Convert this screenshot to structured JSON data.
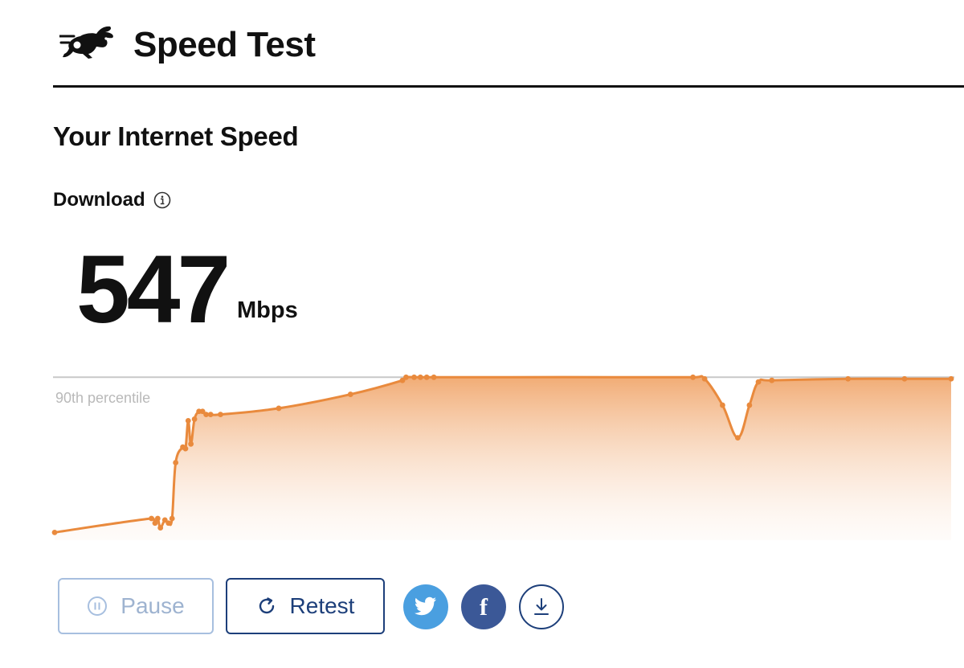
{
  "header": {
    "title": "Speed Test",
    "logo_icon": "rabbit-icon"
  },
  "main": {
    "heading": "Your Internet Speed",
    "metric_label": "Download",
    "info_icon": "info-icon",
    "speed_value": "547",
    "speed_unit": "Mbps"
  },
  "chart_data": {
    "type": "area",
    "title": "",
    "xlabel": "",
    "ylabel": "",
    "reference_line": {
      "label": "90th percentile",
      "value": 1.0
    },
    "x": [
      0,
      10.8,
      11.2,
      11.5,
      11.8,
      12.3,
      12.7,
      13.1,
      13.5,
      14.3,
      14.6,
      14.9,
      15.2,
      15.6,
      16.1,
      16.5,
      16.9,
      17.4,
      18.5,
      25.0,
      33.0,
      38.8,
      39.2,
      40.1,
      40.8,
      41.5,
      42.3,
      71.2,
      72.5,
      74.5,
      76.2,
      77.5,
      78.5,
      80.0,
      88.5,
      94.8,
      100
    ],
    "values": [
      0.0,
      0.09,
      0.06,
      0.09,
      0.03,
      0.08,
      0.06,
      0.09,
      0.45,
      0.55,
      0.54,
      0.72,
      0.57,
      0.73,
      0.78,
      0.78,
      0.76,
      0.76,
      0.76,
      0.8,
      0.89,
      0.98,
      1.0,
      1.0,
      1.0,
      1.0,
      1.0,
      1.0,
      0.99,
      0.82,
      0.61,
      0.82,
      0.97,
      0.98,
      0.99,
      0.99,
      0.99
    ],
    "ylim": [
      -0.05,
      1.1
    ],
    "grid": false,
    "legend": "none",
    "colors": {
      "line": "#e98a3d",
      "fill_top": "#f0a468",
      "reference_line": "#c8c8c8"
    }
  },
  "actions": {
    "pause_label": "Pause",
    "pause_icon": "pause-circle-icon",
    "retest_label": "Retest",
    "retest_icon": "refresh-icon",
    "share_twitter_icon": "twitter-icon",
    "share_facebook_icon": "facebook-icon",
    "download_icon": "download-icon"
  },
  "colors": {
    "text": "#111111",
    "accent_navy": "#1d3f7a",
    "disabled_blue": "#a7bfdf",
    "twitter": "#4a9fe0",
    "facebook": "#3b5897"
  }
}
